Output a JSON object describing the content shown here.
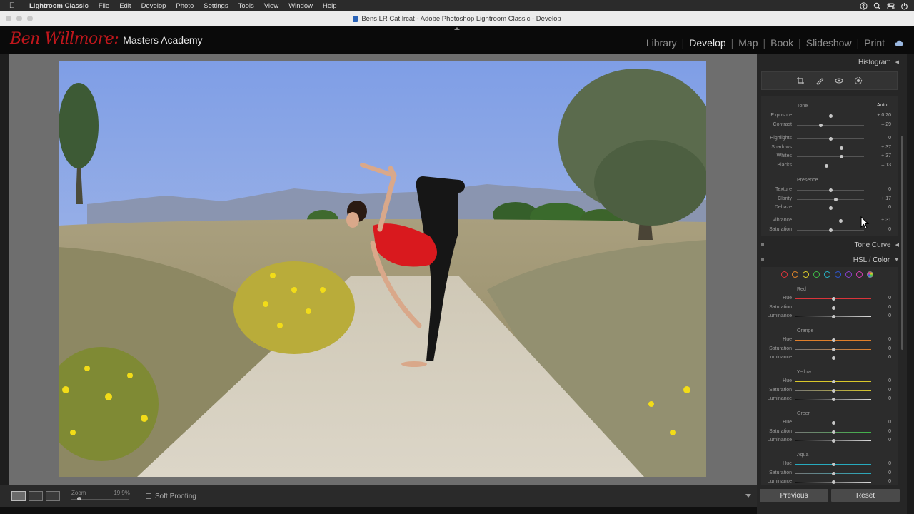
{
  "menubar": {
    "items": [
      "Lightroom Classic",
      "File",
      "Edit",
      "Develop",
      "Photo",
      "Settings",
      "Tools",
      "View",
      "Window",
      "Help"
    ]
  },
  "window": {
    "title": "Bens LR Cat.lrcat - Adobe Photoshop Lightroom Classic - Develop"
  },
  "identity": {
    "script": "Ben Willmore:",
    "subtitle": "Masters Academy"
  },
  "modules": [
    {
      "label": "Library",
      "active": false
    },
    {
      "label": "Develop",
      "active": true
    },
    {
      "label": "Map",
      "active": false
    },
    {
      "label": "Book",
      "active": false
    },
    {
      "label": "Slideshow",
      "active": false
    },
    {
      "label": "Print",
      "active": false
    }
  ],
  "toolbar": {
    "zoom_label": "Zoom",
    "zoom_value": "19.9%",
    "soft_proofing": "Soft Proofing"
  },
  "panels": {
    "histogram": "Histogram",
    "tone_curve": "Tone Curve",
    "hsl_title": "HSL",
    "hsl_slash": " / ",
    "color_title": "Color"
  },
  "basic": {
    "tone_label": "Tone",
    "auto_label": "Auto",
    "presence_label": "Presence",
    "tone_rows": [
      {
        "label": "Exposure",
        "value": "+ 0.20",
        "pos": 0.5
      },
      {
        "label": "Contrast",
        "value": "– 29",
        "pos": 0.36
      }
    ],
    "tone_rows2": [
      {
        "label": "Highlights",
        "value": "0",
        "pos": 0.5
      },
      {
        "label": "Shadows",
        "value": "+ 37",
        "pos": 0.67
      },
      {
        "label": "Whites",
        "value": "+ 37",
        "pos": 0.67
      },
      {
        "label": "Blacks",
        "value": "– 13",
        "pos": 0.44
      }
    ],
    "presence_rows": [
      {
        "label": "Texture",
        "value": "0",
        "pos": 0.5
      },
      {
        "label": "Clarity",
        "value": "+ 17",
        "pos": 0.58
      },
      {
        "label": "Dehaze",
        "value": "0",
        "pos": 0.5
      }
    ],
    "presence_rows2": [
      {
        "label": "Vibrance",
        "value": "+ 31",
        "pos": 0.65
      },
      {
        "label": "Saturation",
        "value": "0",
        "pos": 0.5
      }
    ]
  },
  "hsl": {
    "swatch_colors": [
      "#e0353a",
      "#e8882a",
      "#e0d02a",
      "#3fbf48",
      "#27b5c9",
      "#2f58d6",
      "#8a3fd0",
      "#d63fb4"
    ],
    "groups": [
      {
        "name": "Red",
        "color": "#d9343a",
        "rows": [
          {
            "label": "Hue",
            "value": "0"
          },
          {
            "label": "Saturation",
            "value": "0"
          },
          {
            "label": "Luminance",
            "value": "0"
          }
        ]
      },
      {
        "name": "Orange",
        "color": "#e07f2a",
        "rows": [
          {
            "label": "Hue",
            "value": "0"
          },
          {
            "label": "Saturation",
            "value": "0"
          },
          {
            "label": "Luminance",
            "value": "0"
          }
        ]
      },
      {
        "name": "Yellow",
        "color": "#d8c72a",
        "rows": [
          {
            "label": "Hue",
            "value": "0"
          },
          {
            "label": "Saturation",
            "value": "0"
          },
          {
            "label": "Luminance",
            "value": "0"
          }
        ]
      },
      {
        "name": "Green",
        "color": "#3fb648",
        "rows": [
          {
            "label": "Hue",
            "value": "0"
          },
          {
            "label": "Saturation",
            "value": "0"
          },
          {
            "label": "Luminance",
            "value": "0"
          }
        ]
      },
      {
        "name": "Aqua",
        "color": "#27aabe",
        "rows": [
          {
            "label": "Hue",
            "value": "0"
          },
          {
            "label": "Saturation",
            "value": "0"
          },
          {
            "label": "Luminance",
            "value": "0"
          }
        ]
      }
    ]
  },
  "buttons": {
    "previous": "Previous",
    "reset": "Reset"
  }
}
